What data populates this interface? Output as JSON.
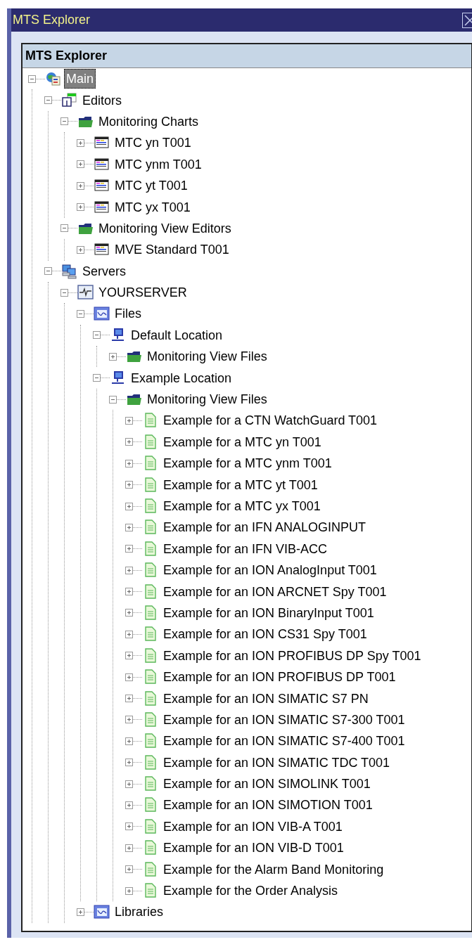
{
  "window": {
    "title": "MTS Explorer"
  },
  "panel": {
    "title": "MTS Explorer"
  },
  "tree": [
    {
      "label": "Main",
      "kind": "globe",
      "expanded": true,
      "selected": true,
      "children": [
        {
          "label": "Editors",
          "kind": "editors",
          "expanded": true,
          "selected": false,
          "children": [
            {
              "label": "Monitoring Charts",
              "kind": "folder",
              "expanded": true,
              "selected": false,
              "children": [
                {
                  "label": "MTC yn T001",
                  "kind": "chart",
                  "expanded": false,
                  "selected": false
                },
                {
                  "label": "MTC ynm T001",
                  "kind": "chart",
                  "expanded": false,
                  "selected": false
                },
                {
                  "label": "MTC yt T001",
                  "kind": "chart",
                  "expanded": false,
                  "selected": false
                },
                {
                  "label": "MTC yx T001",
                  "kind": "chart",
                  "expanded": false,
                  "selected": false
                }
              ]
            },
            {
              "label": "Monitoring View Editors",
              "kind": "folder",
              "expanded": true,
              "selected": false,
              "children": [
                {
                  "label": "MVE Standard T001",
                  "kind": "chart",
                  "expanded": false,
                  "selected": false
                }
              ]
            }
          ]
        },
        {
          "label": "Servers",
          "kind": "servers",
          "expanded": true,
          "selected": false,
          "children": [
            {
              "label": "YOURSERVER",
              "kind": "server",
              "expanded": true,
              "selected": false,
              "children": [
                {
                  "label": "Files",
                  "kind": "files",
                  "expanded": true,
                  "selected": false,
                  "children": [
                    {
                      "label": "Default Location",
                      "kind": "location",
                      "expanded": true,
                      "selected": false,
                      "children": [
                        {
                          "label": "Monitoring View Files",
                          "kind": "folder",
                          "expanded": false,
                          "selected": false
                        }
                      ]
                    },
                    {
                      "label": "Example Location",
                      "kind": "location",
                      "expanded": true,
                      "selected": false,
                      "children": [
                        {
                          "label": "Monitoring View Files",
                          "kind": "folder",
                          "expanded": true,
                          "selected": false,
                          "children": [
                            {
                              "label": "Example for a CTN WatchGuard T001",
                              "kind": "document",
                              "expanded": false,
                              "selected": false
                            },
                            {
                              "label": "Example for a MTC yn T001",
                              "kind": "document",
                              "expanded": false,
                              "selected": false
                            },
                            {
                              "label": "Example for a MTC ynm T001",
                              "kind": "document",
                              "expanded": false,
                              "selected": false
                            },
                            {
                              "label": "Example for a MTC yt T001",
                              "kind": "document",
                              "expanded": false,
                              "selected": false
                            },
                            {
                              "label": "Example for a MTC yx T001",
                              "kind": "document",
                              "expanded": false,
                              "selected": false
                            },
                            {
                              "label": "Example for an IFN ANALOGINPUT",
                              "kind": "document",
                              "expanded": false,
                              "selected": false
                            },
                            {
                              "label": "Example for an IFN VIB-ACC",
                              "kind": "document",
                              "expanded": false,
                              "selected": false
                            },
                            {
                              "label": "Example for an ION AnalogInput T001",
                              "kind": "document",
                              "expanded": false,
                              "selected": false
                            },
                            {
                              "label": "Example for an ION ARCNET Spy T001",
                              "kind": "document",
                              "expanded": false,
                              "selected": false
                            },
                            {
                              "label": "Example for an ION BinaryInput T001",
                              "kind": "document",
                              "expanded": false,
                              "selected": false
                            },
                            {
                              "label": "Example for an ION CS31 Spy T001",
                              "kind": "document",
                              "expanded": false,
                              "selected": false
                            },
                            {
                              "label": "Example for an ION PROFIBUS DP Spy T001",
                              "kind": "document",
                              "expanded": false,
                              "selected": false
                            },
                            {
                              "label": "Example for an ION PROFIBUS DP T001",
                              "kind": "document",
                              "expanded": false,
                              "selected": false
                            },
                            {
                              "label": "Example for an ION SIMATIC S7 PN",
                              "kind": "document",
                              "expanded": false,
                              "selected": false
                            },
                            {
                              "label": "Example for an ION SIMATIC S7-300 T001",
                              "kind": "document",
                              "expanded": false,
                              "selected": false
                            },
                            {
                              "label": "Example for an ION SIMATIC S7-400 T001",
                              "kind": "document",
                              "expanded": false,
                              "selected": false
                            },
                            {
                              "label": "Example for an ION SIMATIC TDC T001",
                              "kind": "document",
                              "expanded": false,
                              "selected": false
                            },
                            {
                              "label": "Example for an ION SIMOLINK T001",
                              "kind": "document",
                              "expanded": false,
                              "selected": false
                            },
                            {
                              "label": "Example for an ION SIMOTION T001",
                              "kind": "document",
                              "expanded": false,
                              "selected": false
                            },
                            {
                              "label": "Example for an ION VIB-A T001",
                              "kind": "document",
                              "expanded": false,
                              "selected": false
                            },
                            {
                              "label": "Example for an ION VIB-D T001",
                              "kind": "document",
                              "expanded": false,
                              "selected": false
                            },
                            {
                              "label": "Example for the Alarm Band Monitoring",
                              "kind": "document",
                              "expanded": false,
                              "selected": false
                            },
                            {
                              "label": "Example for the Order Analysis",
                              "kind": "document",
                              "expanded": false,
                              "selected": false
                            }
                          ]
                        }
                      ]
                    }
                  ]
                },
                {
                  "label": "Libraries",
                  "kind": "files",
                  "expanded": false,
                  "selected": false
                }
              ]
            }
          ]
        }
      ]
    }
  ]
}
